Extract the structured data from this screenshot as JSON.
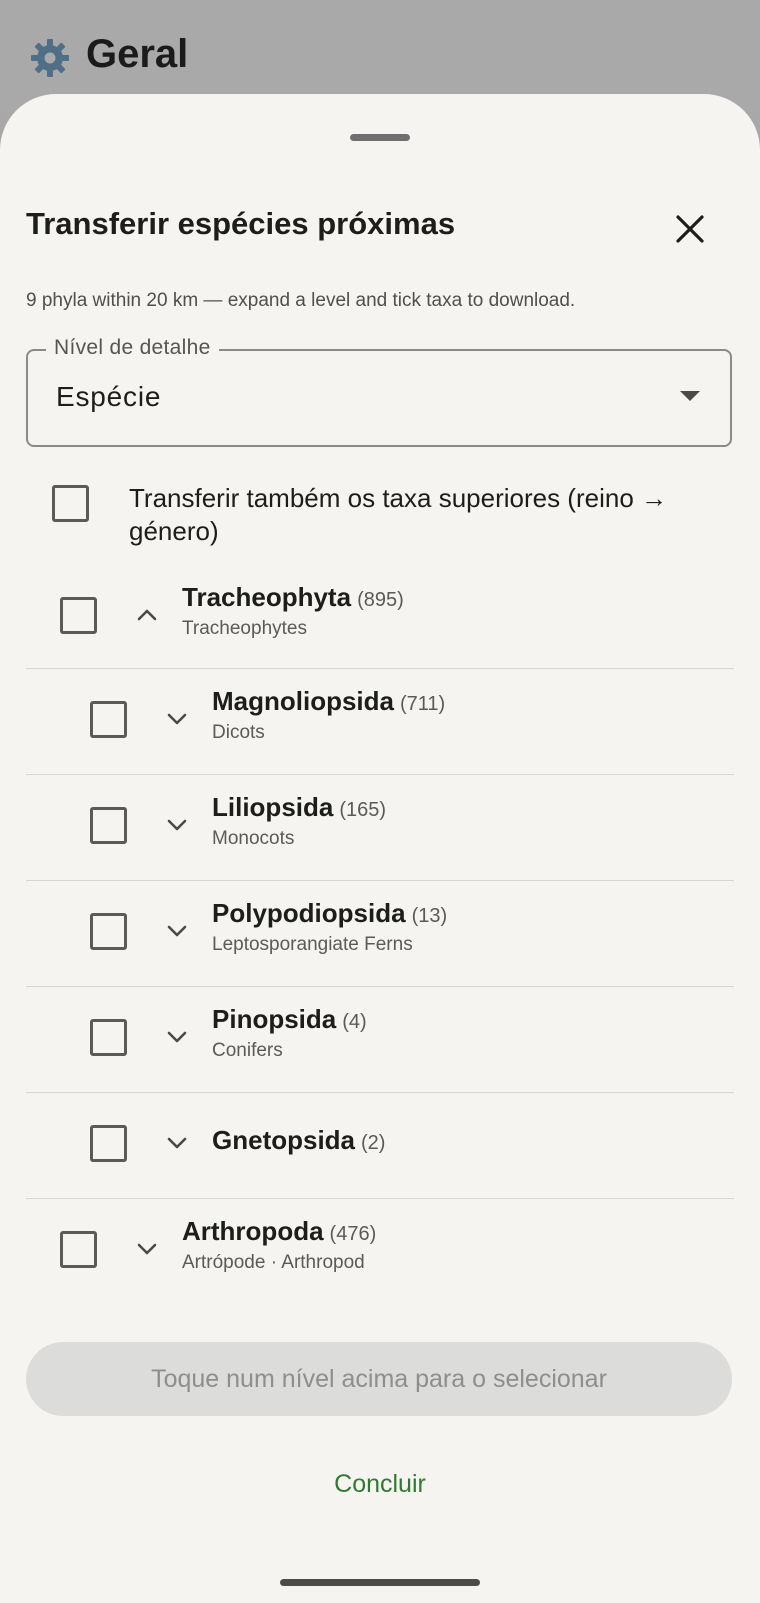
{
  "app": {
    "title": "Geral"
  },
  "sheet": {
    "title": "Transferir espécies próximas",
    "subtitle": "9 phyla within 20 km — expand a level and tick taxa to download.",
    "detail_field": {
      "legend": "Nível de detalhe",
      "value": "Espécie"
    },
    "include_higher": {
      "label": "Transferir também os taxa superiores (reino → género)",
      "checked": false
    },
    "taxa": [
      {
        "name": "Tracheophyta",
        "count": "(895)",
        "common": "Tracheophytes",
        "level": 0,
        "expanded": true,
        "checked": false
      },
      {
        "name": "Magnoliopsida",
        "count": "(711)",
        "common": "Dicots",
        "level": 1,
        "expanded": false,
        "checked": false
      },
      {
        "name": "Liliopsida",
        "count": "(165)",
        "common": "Monocots",
        "level": 1,
        "expanded": false,
        "checked": false
      },
      {
        "name": "Polypodiopsida",
        "count": "(13)",
        "common": "Leptosporangiate Ferns",
        "level": 1,
        "expanded": false,
        "checked": false
      },
      {
        "name": "Pinopsida",
        "count": "(4)",
        "common": "Conifers",
        "level": 1,
        "expanded": false,
        "checked": false
      },
      {
        "name": "Gnetopsida",
        "count": "(2)",
        "common": "",
        "level": 1,
        "expanded": false,
        "checked": false
      },
      {
        "name": "Arthropoda",
        "count": "(476)",
        "common": "Artrópode · Arthropod",
        "level": 0,
        "expanded": false,
        "checked": false
      }
    ],
    "action_button": {
      "label": "Toque num nível acima para o selecionar",
      "enabled": false
    },
    "done_label": "Concluir"
  },
  "colors": {
    "accent": "#2f7a2f",
    "sheet_bg": "#f5f4f1",
    "scrim": "#a8a8a8"
  }
}
